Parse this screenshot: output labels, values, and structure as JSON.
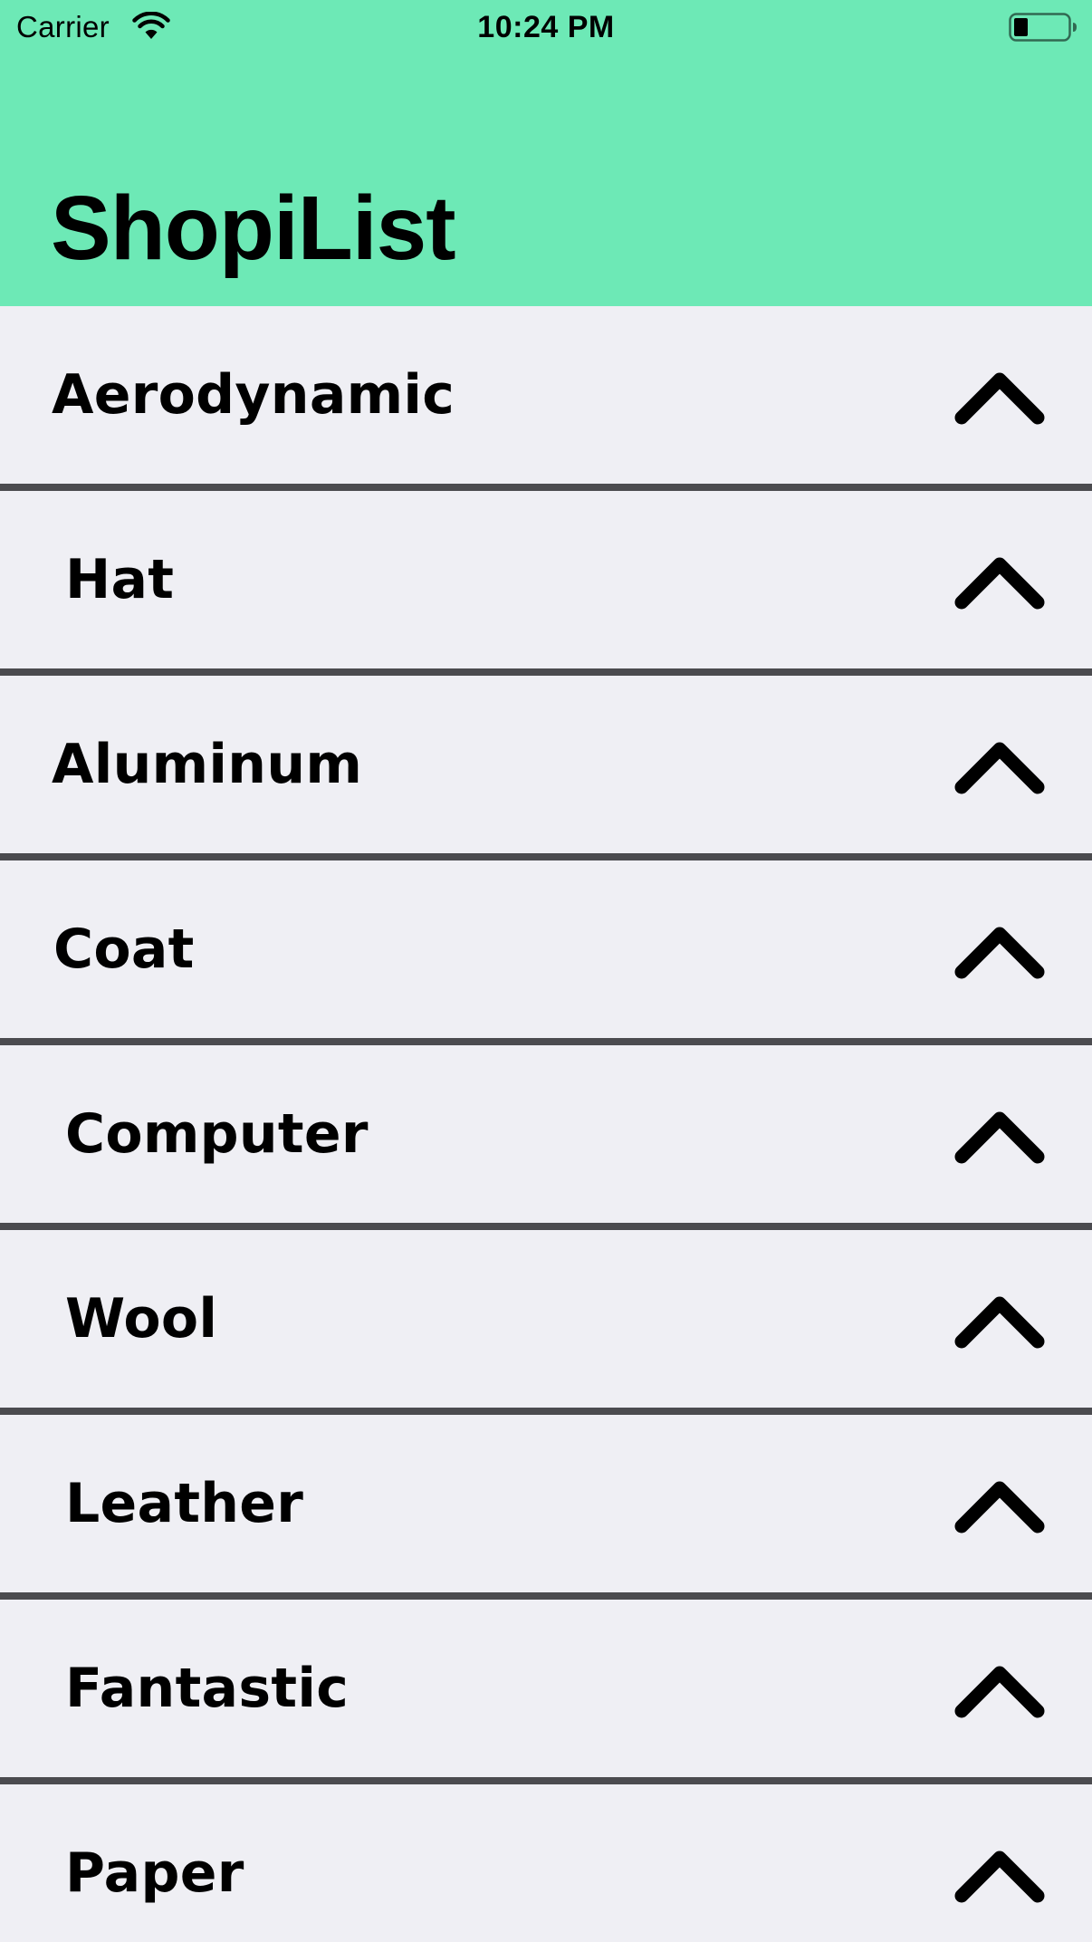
{
  "status_bar": {
    "carrier": "Carrier",
    "time": "10:24 PM",
    "wifi_icon": "wifi-icon",
    "battery_icon": "battery-icon"
  },
  "header": {
    "title": "ShopiList",
    "background_color": "#6de9b6"
  },
  "list": {
    "background_color": "#efeff4",
    "divider_color": "#4b4b4f",
    "items": [
      {
        "label": "Aerodynamic",
        "icon": "chevron-up-icon"
      },
      {
        "label": "Hat",
        "icon": "chevron-up-icon"
      },
      {
        "label": "Aluminum",
        "icon": "chevron-up-icon"
      },
      {
        "label": "Coat",
        "icon": "chevron-up-icon"
      },
      {
        "label": "Computer",
        "icon": "chevron-up-icon"
      },
      {
        "label": "Wool",
        "icon": "chevron-up-icon"
      },
      {
        "label": "Leather",
        "icon": "chevron-up-icon"
      },
      {
        "label": "Fantastic",
        "icon": "chevron-up-icon"
      },
      {
        "label": "Paper",
        "icon": "chevron-up-icon"
      }
    ]
  }
}
